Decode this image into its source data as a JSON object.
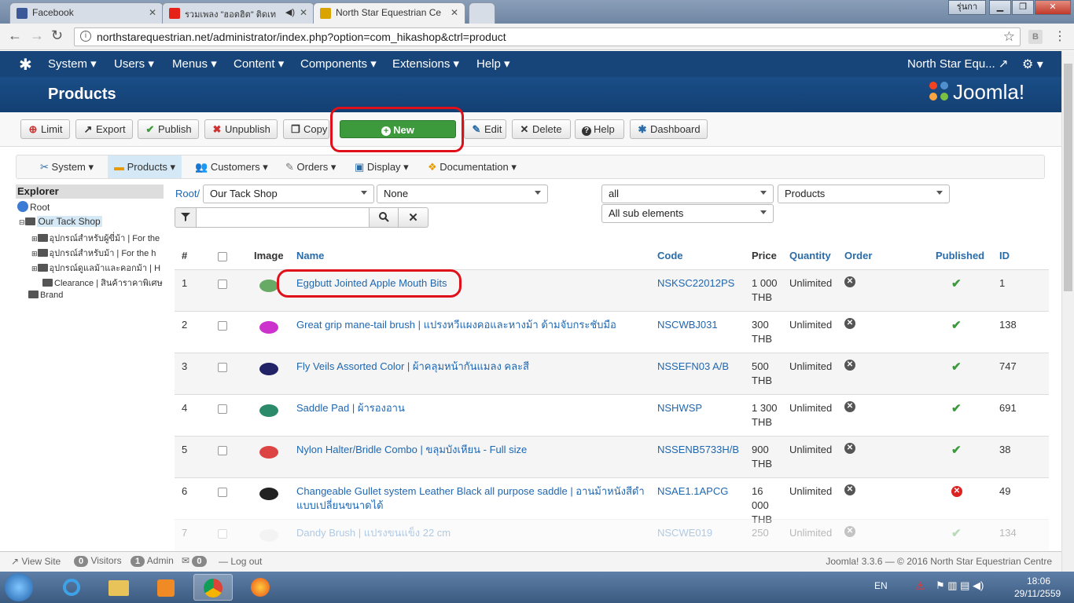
{
  "browser": {
    "tabs": [
      {
        "label": "Facebook",
        "color": "#3b5998"
      },
      {
        "label": "รวมเพลง \"ฮอตฮิต\" ติดเท",
        "color": "#e62117"
      },
      {
        "label": "North Star Equestrian Ce",
        "color": "#d9a400"
      }
    ],
    "window_label": "รุ่นกา",
    "url": "northstarequestrian.net/administrator/index.php?option=com_hikashop&ctrl=product"
  },
  "joomla": {
    "menus": [
      "System",
      "Users",
      "Menus",
      "Content",
      "Components",
      "Extensions",
      "Help"
    ],
    "site_name": "North Star Equ...",
    "page_title": "Products",
    "logo": "Joomla!"
  },
  "toolbar": {
    "buttons": [
      {
        "label": "Limit",
        "icon": "⊕"
      },
      {
        "label": "Export",
        "icon": "↗"
      },
      {
        "label": "Publish",
        "icon": "✔"
      },
      {
        "label": "Unpublish",
        "icon": "✖"
      },
      {
        "label": "Copy",
        "icon": "❐"
      },
      {
        "label": "New",
        "icon": "+"
      },
      {
        "label": "Edit",
        "icon": "✎"
      },
      {
        "label": "Delete",
        "icon": "✕"
      },
      {
        "label": "Help",
        "icon": "?"
      },
      {
        "label": "Dashboard",
        "icon": "✱"
      }
    ]
  },
  "hikamenu": {
    "items": [
      "System",
      "Products",
      "Customers",
      "Orders",
      "Display",
      "Documentation"
    ]
  },
  "explorer": {
    "title": "Explorer",
    "root": "Root",
    "shop": "Our Tack Shop",
    "children": [
      "อุปกรณ์สำหรับผู้ขี่ม้า | For the",
      "อุปกรณ์สำหรับม้า | For the h",
      "อุปกรณ์ดูแลม้าและคอกม้า | H",
      "Clearance | สินค้าราคาพิเศษ"
    ],
    "brand": "Brand"
  },
  "filters": {
    "root_link": "Root/",
    "category": "Our Tack Shop",
    "none": "None",
    "all": "all",
    "type": "Products",
    "sub": "All sub elements"
  },
  "table": {
    "headers": {
      "num": "#",
      "image": "Image",
      "name": "Name",
      "code": "Code",
      "price": "Price",
      "quantity": "Quantity",
      "order": "Order",
      "published": "Published",
      "id": "ID"
    },
    "rows": [
      {
        "num": "1",
        "name": "Eggbutt Jointed Apple Mouth Bits",
        "name2": "",
        "code": "NSKSC22012PS",
        "price1": "1 000",
        "price2": "THB",
        "price3": "",
        "qty": "Unlimited",
        "published": true,
        "id": "1"
      },
      {
        "num": "2",
        "name": "Great grip mane-tail brush | แปรงหวีแผงคอและหางม้า ด้ามจับกระชับมือ",
        "name2": "",
        "code": "NSCWBJ031",
        "price1": "300",
        "price2": "THB",
        "price3": "",
        "qty": "Unlimited",
        "published": true,
        "id": "138"
      },
      {
        "num": "3",
        "name": "Fly Veils Assorted Color | ผ้าคลุมหน้ากันแมลง คละสี",
        "name2": "",
        "code": "NSSEFN03 A/B",
        "price1": "500",
        "price2": "THB",
        "price3": "",
        "qty": "Unlimited",
        "published": true,
        "id": "747"
      },
      {
        "num": "4",
        "name": "Saddle Pad | ผ้ารองอาน",
        "name2": "",
        "code": "NSHWSP",
        "price1": "1 300",
        "price2": "THB",
        "price3": "",
        "qty": "Unlimited",
        "published": true,
        "id": "691"
      },
      {
        "num": "5",
        "name": "Nylon Halter/Bridle Combo | ขลุมบังเหียน - Full size",
        "name2": "",
        "code": "NSSENB5733H/B",
        "price1": "900",
        "price2": "THB",
        "price3": "",
        "qty": "Unlimited",
        "published": true,
        "id": "38"
      },
      {
        "num": "6",
        "name": "Changeable Gullet system Leather Black all purpose saddle | อานม้าหนังสีดำ",
        "name2": "แบบเปลี่ยนขนาดได้",
        "code": "NSAE1.1APCG",
        "price1": "16",
        "price2": "000",
        "price3": "THB",
        "qty": "Unlimited",
        "published": false,
        "id": "49"
      },
      {
        "num": "7",
        "name": "Dandy Brush | แปรงขนแข็ง 22 cm",
        "name2": "",
        "code": "NSCWE019",
        "price1": "250",
        "price2": "",
        "price3": "",
        "qty": "Unlimited",
        "published": true,
        "id": "134"
      }
    ]
  },
  "status": {
    "view_site": "View Site",
    "visitors_count": "0",
    "visitors": "Visitors",
    "admin_count": "1",
    "admin": "Admin",
    "msg_count": "0",
    "logout": "Log out",
    "footer": "Joomla! 3.3.6  —  © 2016 North Star Equestrian Centre"
  },
  "taskbar": {
    "lang": "EN",
    "time": "18:06",
    "date": "29/11/2559"
  }
}
